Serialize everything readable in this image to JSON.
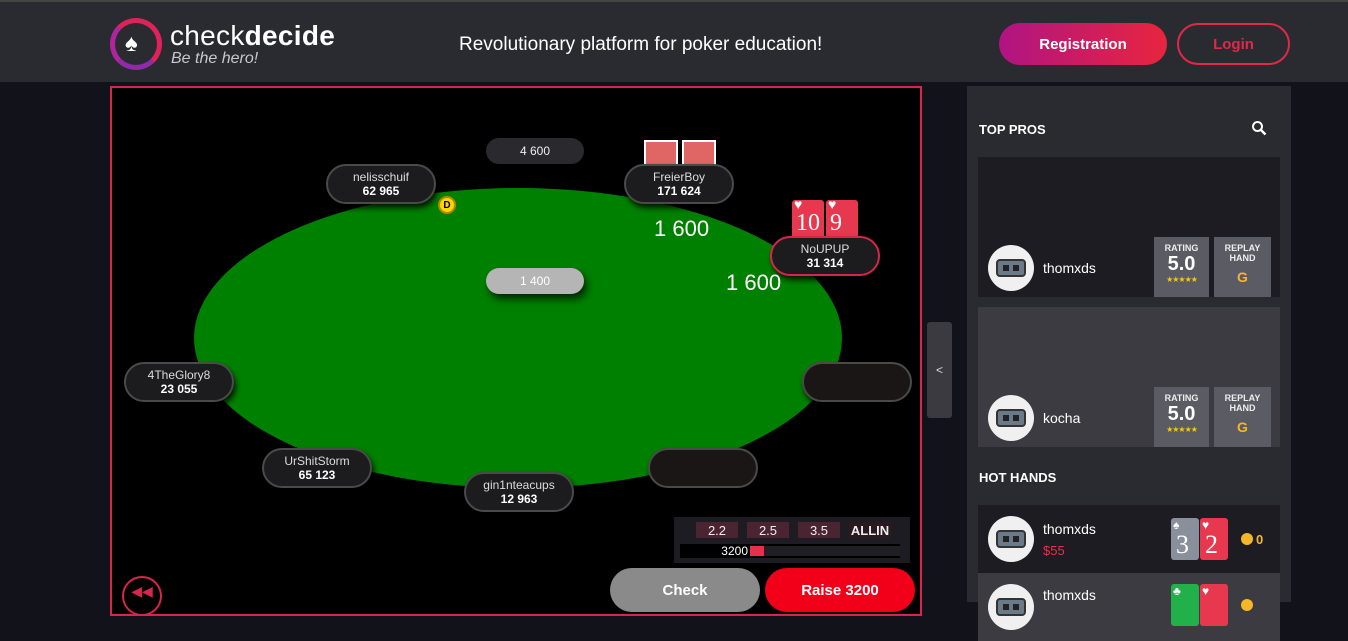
{
  "header": {
    "brand_light": "check",
    "brand_bold": "decide",
    "tagline": "Be the hero!",
    "headline": "Revolutionary platform for poker education!",
    "registration_label": "Registration",
    "login_label": "Login"
  },
  "table": {
    "pot_top": "4 600",
    "pot_center": "1 400",
    "bet_freierboy": "1 600",
    "bet_noupup": "1 600",
    "dealer_label": "D",
    "seats": [
      {
        "name": "nelisschuif",
        "stack": "62 965"
      },
      {
        "name": "FreierBoy",
        "stack": "171 624"
      },
      {
        "name": "NoUPUP",
        "stack": "31 314"
      },
      {
        "name": "4TheGlory8",
        "stack": "23 055"
      },
      {
        "name": "UrShitStorm",
        "stack": "65 123"
      },
      {
        "name": "gin1nteacups",
        "stack": "12 963"
      }
    ],
    "hero_cards": [
      {
        "rank": "10",
        "suit": "♥"
      },
      {
        "rank": "9",
        "suit": "♥"
      }
    ]
  },
  "controls": {
    "presets": [
      "2.2",
      "2.5",
      "3.5",
      "ALLIN"
    ],
    "slider_value": "3200",
    "slider_fraction": 0.1,
    "check_label": "Check",
    "raise_label": "Raise 3200",
    "rewind_glyph": "◀◀",
    "collapse_glyph": "<"
  },
  "sidebar": {
    "top_pros_title": "TOP PROS",
    "hot_hands_title": "HOT HANDS",
    "rating_label": "RATING",
    "replay_label_1": "REPLAY",
    "replay_label_2": "HAND",
    "stars": "★★★★★",
    "pros": [
      {
        "name": "thomxds",
        "rating": "5.0",
        "grade": "G"
      },
      {
        "name": "kocha",
        "rating": "5.0",
        "grade": "G"
      }
    ],
    "hot_hands": [
      {
        "name": "thomxds",
        "price": "$55",
        "cards": [
          {
            "rank": "3",
            "suit": "♠"
          },
          {
            "rank": "2",
            "suit": "♥"
          }
        ],
        "coins": "0"
      },
      {
        "name": "thomxds",
        "price": "",
        "cards": [
          {
            "rank": "",
            "suit": "♣"
          },
          {
            "rank": "",
            "suit": "♥"
          }
        ],
        "coins": ""
      }
    ]
  },
  "colors": {
    "accent": "#e02847",
    "felt": "#008000",
    "panel": "#2a2b31"
  }
}
